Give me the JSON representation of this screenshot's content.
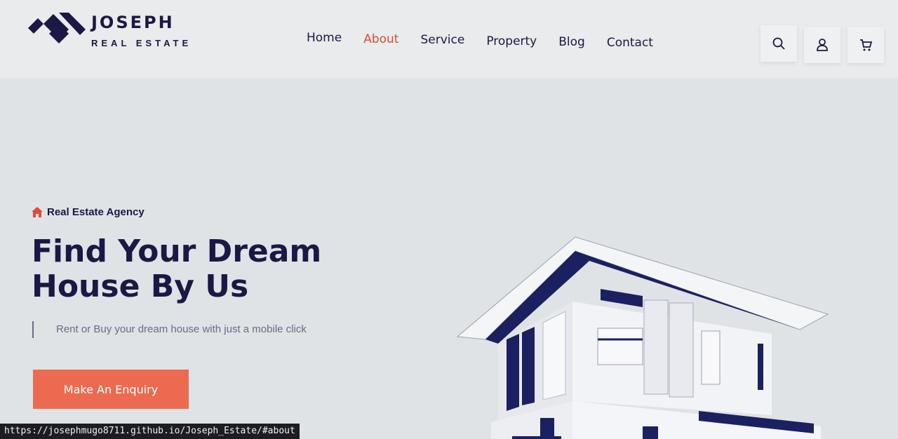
{
  "brand": {
    "name": "JOSEPH",
    "tagline": "REAL ESTATE",
    "accent": "#ec6a4f",
    "navy": "#1b1845"
  },
  "nav": [
    {
      "label": "Home",
      "active": false
    },
    {
      "label": "About",
      "active": true
    },
    {
      "label": "Service",
      "active": false
    },
    {
      "label": "Property",
      "active": false
    },
    {
      "label": "Blog",
      "active": false
    },
    {
      "label": "Contact",
      "active": false
    }
  ],
  "header_icons": [
    "search-icon",
    "user-icon",
    "cart-icon"
  ],
  "hero": {
    "eyebrow": "Real Estate Agency",
    "eyebrow_icon": "home-icon",
    "headline_line1": "Find Your Dream",
    "headline_line2": "House By Us",
    "subline": "Rent or Buy your dream house with just a mobile click",
    "cta_label": "Make An Enquiry"
  },
  "status_bar": {
    "url": "https://josephmugo8711.github.io/Joseph_Estate/#about"
  }
}
